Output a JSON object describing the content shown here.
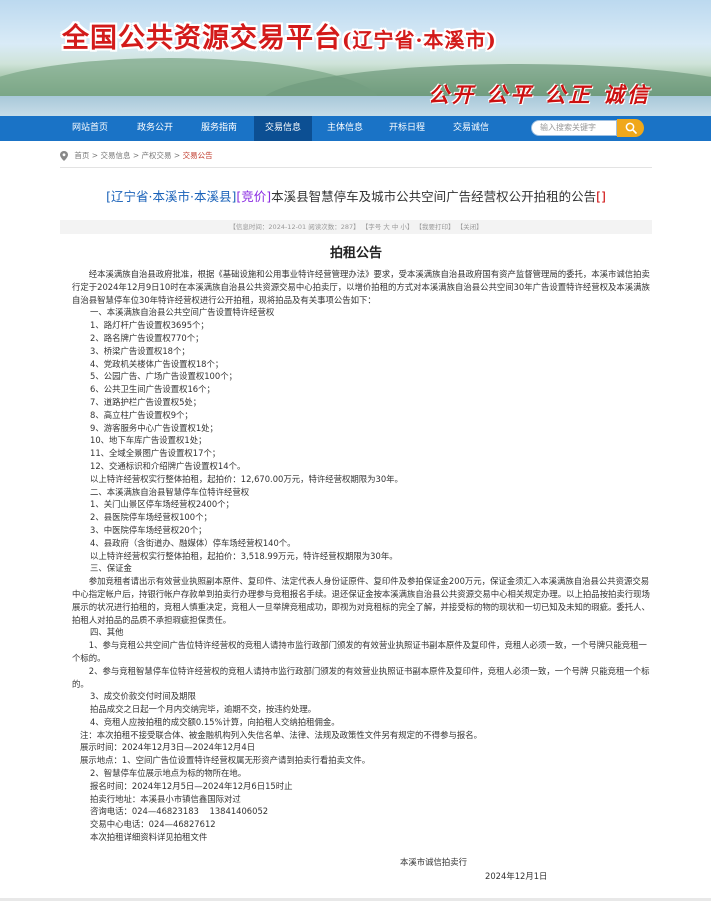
{
  "header": {
    "site_title": "全国公共资源交易平台",
    "site_subtitle": "(辽宁省·本溪市)",
    "slogan": "公开 公平 公正 诚信"
  },
  "nav": {
    "items": [
      "网站首页",
      "政务公开",
      "服务指南",
      "交易信息",
      "主体信息",
      "开标日程",
      "交易诚信"
    ],
    "active_index": 3,
    "search_placeholder": "输入搜索关键字"
  },
  "breadcrumb": {
    "items": [
      "首页",
      "交易信息",
      "产权交易",
      "交易公告"
    ],
    "separator": " > "
  },
  "article": {
    "heading_region": "[辽宁省·本溪市·本溪县]",
    "heading_type": "[竞价]",
    "heading_title": "本溪县智慧停车及城市公共空间广告经营权公开拍租的公告",
    "heading_tail": "[]",
    "meta": "【信息时间：2024-12-01  阅读次数：287】  【字号 大 中 小】  【我要打印】  【关闭】",
    "doc_title": "拍租公告",
    "intro": "经本溪满族自治县政府批准，根据《基础设施和公用事业特许经营管理办法》要求，受本溪满族自治县政府国有资产监督管理局的委托，本溪市诚信拍卖行定于2024年12月9日10时在本溪满族自治县公共资源交易中心拍卖厅，以增价拍租的方式对本溪满族自治县公共空间30年广告设置特许经营权及本溪满族自治县智慧停车位30年特许经营权进行公开拍租，现将拍品及有关事项公告如下：",
    "section1_title": "一、本溪满族自治县公共空间广告设置特许经营权",
    "section1_items": [
      "1、路灯杆广告设置权3695个；",
      "2、路名牌广告设置权770个；",
      "3、桥梁广告设置权18个；",
      "4、党政机关楼体广告设置权18个；",
      "5、公园广告、广场广告设置权100个；",
      "6、公共卫生间广告设置权16个；",
      "7、道路护栏广告设置权5处；",
      "8、高立柱广告设置权9个；",
      "9、游客服务中心广告设置权1处；",
      "10、地下车库广告设置权1处；",
      "11、全域全景图广告设置权17个；",
      "12、交通标识和介绍牌广告设置权14个。"
    ],
    "section1_summary": "以上特许经营权实行整体拍租，起拍价：12,670.00万元，特许经营权期限为30年。",
    "section2_title": "二、本溪满族自治县智慧停车位特许经营权",
    "section2_items": [
      "1、关门山景区停车场经营权2400个；",
      "2、县医院停车场经营权100个；",
      "3、中医院停车场经营权20个；",
      "4、县政府（含街道办、融媒体）停车场经营权140个。"
    ],
    "section2_summary": "以上特许经营权实行整体拍租，起拍价：3,518.99万元，特许经营权期限为30年。",
    "section3_title": "三、保证金",
    "section3_text": "参加竞租者请出示有效营业执照副本原件、复印件、法定代表人身份证原件、复印件及参拍保证金200万元，保证金须汇入本溪满族自治县公共资源交易中心指定帐户后，持银行帐户存款单到拍卖行办理参与竞租报名手续。退还保证金按本溪满族自治县公共资源交易中心相关规定办理。以上拍品按拍卖行现场展示的状况进行拍租的，竞租人慎重决定，竞租人一旦举牌竞租成功，即视为对竞租标的完全了解，并接受标的物的现状和一切已知及未知的瑕疵。委托人、拍租人对拍品的品质不承担瑕疵担保责任。",
    "section4_title": "四、其他",
    "section4_p1": "1、参与竞租公共空间广告位特许经营权的竞租人请持市监行政部门颁发的有效营业执照证书副本原件及复印件，竞租人必须一致，一个号牌只能竞租一个标的。",
    "section4_p2": "2、参与竞租智慧停车位特许经营权的竞租人请持市监行政部门颁发的有效营业执照证书副本原件及复印件，竞租人必须一致，一个号牌  只能竞租一个标的。",
    "section4_lines": [
      "3、成交价款交付时间及期限",
      "拍品成交之日起一个月内交纳完毕，逾期不交，按违约处理。",
      "4、竞租人应按拍租的成交额0.15%计算，向拍租人交纳拍租佣金。",
      "注：本次拍租不接受联合体、被金融机构列入失信名单、法律、法规及政策性文件另有规定的不得参与报名。",
      "展示时间：2024年12月3日—2024年12月4日",
      "展示地点：1、空间广告位设置特许经营权属无形资产请到拍卖行看拍卖文件。",
      "2、智慧停车位展示地点为标的物所在地。",
      "报名时间：2024年12月5日—2024年12月6日15时止",
      "拍卖行地址：本溪县小市镇信鑫国际对过",
      "咨询电话：024—46823183    13841406052",
      "交易中心电话：024—46827612",
      "本次拍租详细资料详见拍租文件"
    ],
    "signature": "本溪市诚信拍卖行",
    "date": "2024年12月1日"
  }
}
